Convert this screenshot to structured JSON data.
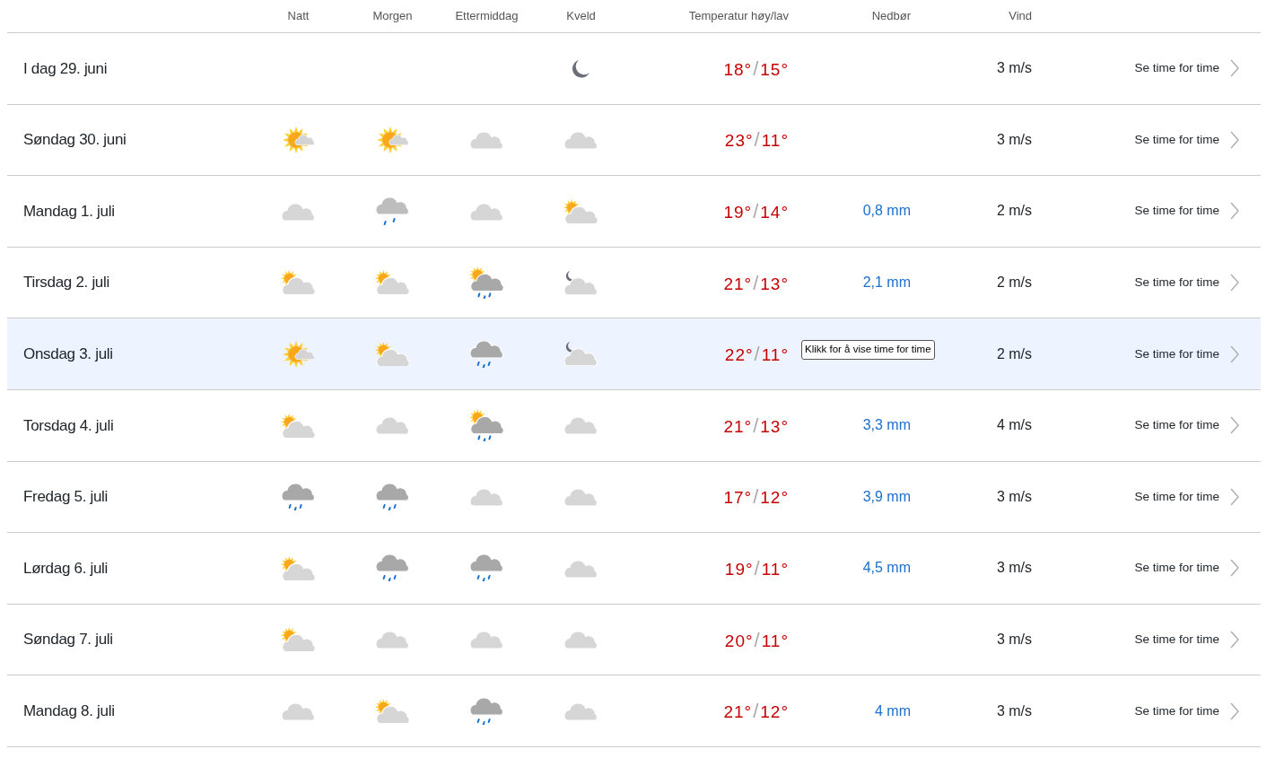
{
  "columns": {
    "night": "Natt",
    "morning": "Morgen",
    "afternoon": "Ettermiddag",
    "evening": "Kveld",
    "temperature": "Temperatur høy/lav",
    "precipitation": "Nedbør",
    "wind": "Vind"
  },
  "rows": [
    {
      "date": "I dag 29. juni",
      "evening": {
        "kind": "night_clear"
      },
      "high": "18°",
      "separator": "/",
      "low": "15°",
      "wind": "3 m/s",
      "link": "Se time for time",
      "selected": false
    },
    {
      "date": "Søndag 30. juni",
      "night": {
        "kind": "sunny_cloud"
      },
      "morning": {
        "kind": "sunny_cloud"
      },
      "afternoon": {
        "kind": "cloudy"
      },
      "evening": {
        "kind": "cloudy"
      },
      "high": "23°",
      "separator": "/",
      "low": "11°",
      "wind": "3 m/s",
      "link": "Se time for time",
      "selected": false
    },
    {
      "date": "Mandag 1. juli",
      "night": {
        "kind": "cloudy"
      },
      "morning": {
        "kind": "light_rain"
      },
      "afternoon": {
        "kind": "cloudy"
      },
      "evening": {
        "kind": "fair"
      },
      "high": "19°",
      "separator": "/",
      "low": "14°",
      "precipitation": "0,8 mm",
      "wind": "2 m/s",
      "link": "Se time for time",
      "selected": false
    },
    {
      "date": "Tirsdag 2. juli",
      "night": {
        "kind": "fair"
      },
      "morning": {
        "kind": "fair"
      },
      "afternoon": {
        "kind": "fair_rain"
      },
      "evening": {
        "kind": "night_fair"
      },
      "high": "21°",
      "separator": "/",
      "low": "13°",
      "precipitation": "2,1 mm",
      "wind": "2 m/s",
      "link": "Se time for time",
      "selected": false
    },
    {
      "date": "Onsdag 3. juli",
      "night": {
        "kind": "sunny_cloud"
      },
      "morning": {
        "kind": "fair"
      },
      "afternoon": {
        "kind": "rain"
      },
      "evening": {
        "kind": "night_fair"
      },
      "high": "22°",
      "separator": "/",
      "low": "11°",
      "wind": "2 m/s",
      "link": "Se time for time",
      "selected": true,
      "tooltip": "Klikk for å vise time for time"
    },
    {
      "date": "Torsdag 4. juli",
      "night": {
        "kind": "fair"
      },
      "morning": {
        "kind": "cloudy"
      },
      "afternoon": {
        "kind": "fair_rain"
      },
      "evening": {
        "kind": "cloudy"
      },
      "high": "21°",
      "separator": "/",
      "low": "13°",
      "precipitation": "3,3 mm",
      "wind": "4 m/s",
      "link": "Se time for time",
      "selected": false
    },
    {
      "date": "Fredag 5. juli",
      "night": {
        "kind": "rain"
      },
      "morning": {
        "kind": "rain"
      },
      "afternoon": {
        "kind": "cloudy"
      },
      "evening": {
        "kind": "cloudy"
      },
      "high": "17°",
      "separator": "/",
      "low": "12°",
      "precipitation": "3,9 mm",
      "wind": "3 m/s",
      "link": "Se time for time",
      "selected": false
    },
    {
      "date": "Lørdag 6. juli",
      "night": {
        "kind": "fair"
      },
      "morning": {
        "kind": "rain"
      },
      "afternoon": {
        "kind": "rain"
      },
      "evening": {
        "kind": "cloudy"
      },
      "high": "19°",
      "separator": "/",
      "low": "11°",
      "precipitation": "4,5 mm",
      "wind": "3 m/s",
      "link": "Se time for time",
      "selected": false
    },
    {
      "date": "Søndag 7. juli",
      "night": {
        "kind": "fair"
      },
      "morning": {
        "kind": "cloudy"
      },
      "afternoon": {
        "kind": "cloudy"
      },
      "evening": {
        "kind": "cloudy"
      },
      "high": "20°",
      "separator": "/",
      "low": "11°",
      "wind": "3 m/s",
      "link": "Se time for time",
      "selected": false
    },
    {
      "date": "Mandag 8. juli",
      "night": {
        "kind": "cloudy"
      },
      "morning": {
        "kind": "fair"
      },
      "afternoon": {
        "kind": "rain"
      },
      "evening": {
        "kind": "cloudy"
      },
      "high": "21°",
      "separator": "/",
      "low": "12°",
      "precipitation": "4 mm",
      "wind": "3 m/s",
      "link": "Se time for time",
      "selected": false
    }
  ]
}
